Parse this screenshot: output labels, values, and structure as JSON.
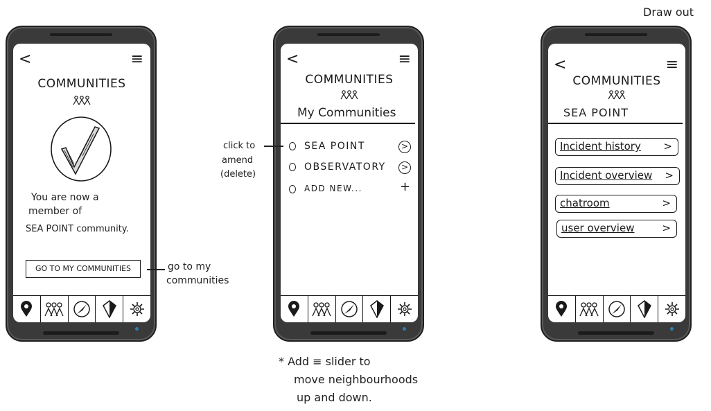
{
  "top_right_note": "Draw out",
  "screen1": {
    "title": "COMMUNITIES",
    "message_line1": "You are now a",
    "message_line2": "member of",
    "message_line3": "SEA POINT community.",
    "button_label": "GO TO MY COMMUNITIES",
    "annotation_line1": "go to my",
    "annotation_line2": "communities"
  },
  "screen2": {
    "title": "COMMUNITIES",
    "subtitle": "My Communities",
    "items": [
      {
        "label": "SEA POINT"
      },
      {
        "label": "OBSERVATORY"
      },
      {
        "label": "ADD NEW..."
      }
    ],
    "annotation_line1": "click to",
    "annotation_line2": "amend",
    "annotation_line3": "(delete)",
    "footnote_line1": "* Add ≡ slider to",
    "footnote_line2": "move neighbourhoods",
    "footnote_line3": "up and down."
  },
  "screen3": {
    "title": "COMMUNITIES",
    "subtitle": "SEA POINT",
    "buttons": [
      {
        "label": "Incident history"
      },
      {
        "label": "Incident overview"
      },
      {
        "label": "chatroom"
      },
      {
        "label": "user overview"
      }
    ]
  },
  "icons": {
    "back": "back-chevron-icon",
    "menu": "hamburger-menu-icon",
    "tabs": [
      "map-pin-icon",
      "people-icon",
      "compass-icon",
      "shield-icon",
      "gear-icon"
    ]
  },
  "colors": {
    "phone_body": "#3a3a3a",
    "ink": "#1a1a1a",
    "led": "#2f7fb0"
  }
}
